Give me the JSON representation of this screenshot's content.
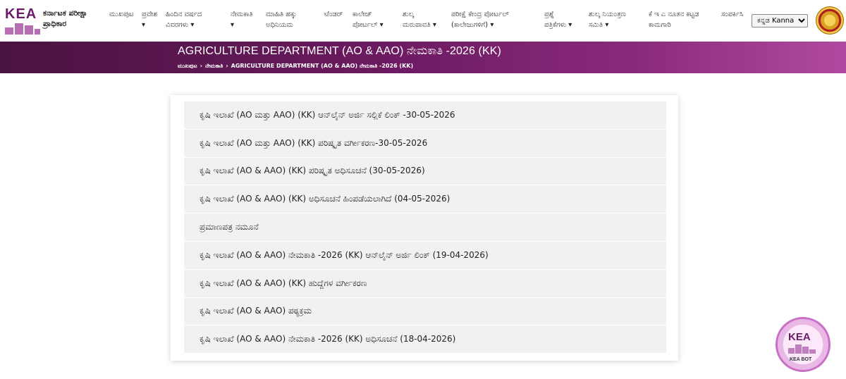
{
  "header": {
    "logo_text": "KEA",
    "org_name": "ಕರ್ನಾಟಕ ಪರೀಕ್ಷಾ ಪ್ರಾಧಿಕಾರ",
    "nav": [
      {
        "line1": "ಮುಖಪುಟ",
        "line2": ""
      },
      {
        "line1": "ಪ್ರವೇಶ",
        "line2": "▾"
      },
      {
        "line1": "ಹಿಂದಿನ ವರ್ಷದ",
        "line2": "ವಿವರಗಳು ▾"
      },
      {
        "line1": "ನೇಮಕಾತಿ",
        "line2": "▾"
      },
      {
        "line1": "ಮಾಹಿತಿ ಹಕ್ಕು",
        "line2": "ಅಧಿನಿಯಮ"
      },
      {
        "line1": "ಟೆಂಡರ್",
        "line2": ""
      },
      {
        "line1": "ಕಾಲೇಜ್",
        "line2": "ಪೋರ್ಟಲ್ ▾"
      },
      {
        "line1": "ಶುಲ್ಕ",
        "line2": "ಮರುಪಾವತಿ ▾"
      },
      {
        "line1": "ಪರೀಕ್ಷೆ ಕೇಂದ್ರ ಪೋರ್ಟಲ್",
        "line2": "(ಕಾಲೇಜುಗಳಿಗೆ) ▾"
      },
      {
        "line1": "ಪ್ರಶ್ನೆ",
        "line2": "ಪತ್ರಿಕೆಗಳು ▾"
      },
      {
        "line1": "ಶುಲ್ಕ ನಿಯಂತ್ರಣ",
        "line2": "ಸಮಿತಿ ▾"
      },
      {
        "line1": "ಕೆ ಇ ಎ ನೂತನ ಕಟ್ಟಡ",
        "line2": "ಕಾಮಗಾರಿ"
      },
      {
        "line1": "ಸಂಪರ್ಕಿಸಿ",
        "line2": ""
      }
    ],
    "language_selected": "ಕನ್ನಡ Kannada"
  },
  "banner": {
    "title": "AGRICULTURE DEPARTMENT (AO & AAO) ನೇಮಕಾತಿ -2026 (KK)",
    "breadcrumb": [
      "ಮುಖಪುಟ",
      "ನೇಮಕಾತಿ",
      "AGRICULTURE DEPARTMENT (AO & AAO) ನೇಮಕಾತಿ -2026 (KK)"
    ]
  },
  "links": [
    "ಕೃಷಿ ಇಲಾಖೆ (AO ಮತ್ತು AAO) (KK) ಆನ್‌ಲೈನ್ ಅರ್ಜಿ ಸಲ್ಲಿಕೆ ಲಿಂಕ್ -30-05-2026",
    "ಕೃಷಿ ಇಲಾಖೆ (AO ಮತ್ತು AAO) (KK) ಪರಿಷ್ಕೃತ ವರ್ಗೀಕರಣ-30-05-2026",
    "ಕೃಷಿ ಇಲಾಖೆ (AO & AAO) (KK) ಪರಿಷ್ಕೃತ ಅಧಿಸೂಚನೆ (30-05-2026)",
    "ಕೃಷಿ ಇಲಾಖೆ (AO & AAO) (KK) ಅಧಿಸೂಚನೆ ಹಿಂಪಡೆಯಲಾಗಿದೆ (04-05-2026)",
    "ಪ್ರಮಾಣಪತ್ರ ನಮೂನೆ",
    "ಕೃಷಿ ಇಲಾಖೆ (AO & AAO) ನೇಮಕಾತಿ -2026 (KK) ಆನ್‌ಲೈನ್ ಅರ್ಜಿ ಲಿಂಕ್ (19-04-2026)",
    "ಕೃಷಿ ಇಲಾಖೆ (AO & AAO) (KK) ಹುದ್ದೆಗಳ ವರ್ಗೀಕರಣ",
    "ಕೃಷಿ ಇಲಾಖೆ (AO & AAO) ಪಠ್ಯಕ್ರಮ",
    "ಕೃಷಿ ಇಲಾಖೆ (AO & AAO) ನೇಮಕಾತಿ -2026 (KK) ಅಧಿಸೂಚನೆ (18-04-2026)"
  ],
  "bot": {
    "logo_text": "KEA",
    "label": "KEA BOT"
  },
  "colors": {
    "brand": "#6a1b6b",
    "banner_start": "#4a1440",
    "banner_end": "#b04aa0"
  }
}
